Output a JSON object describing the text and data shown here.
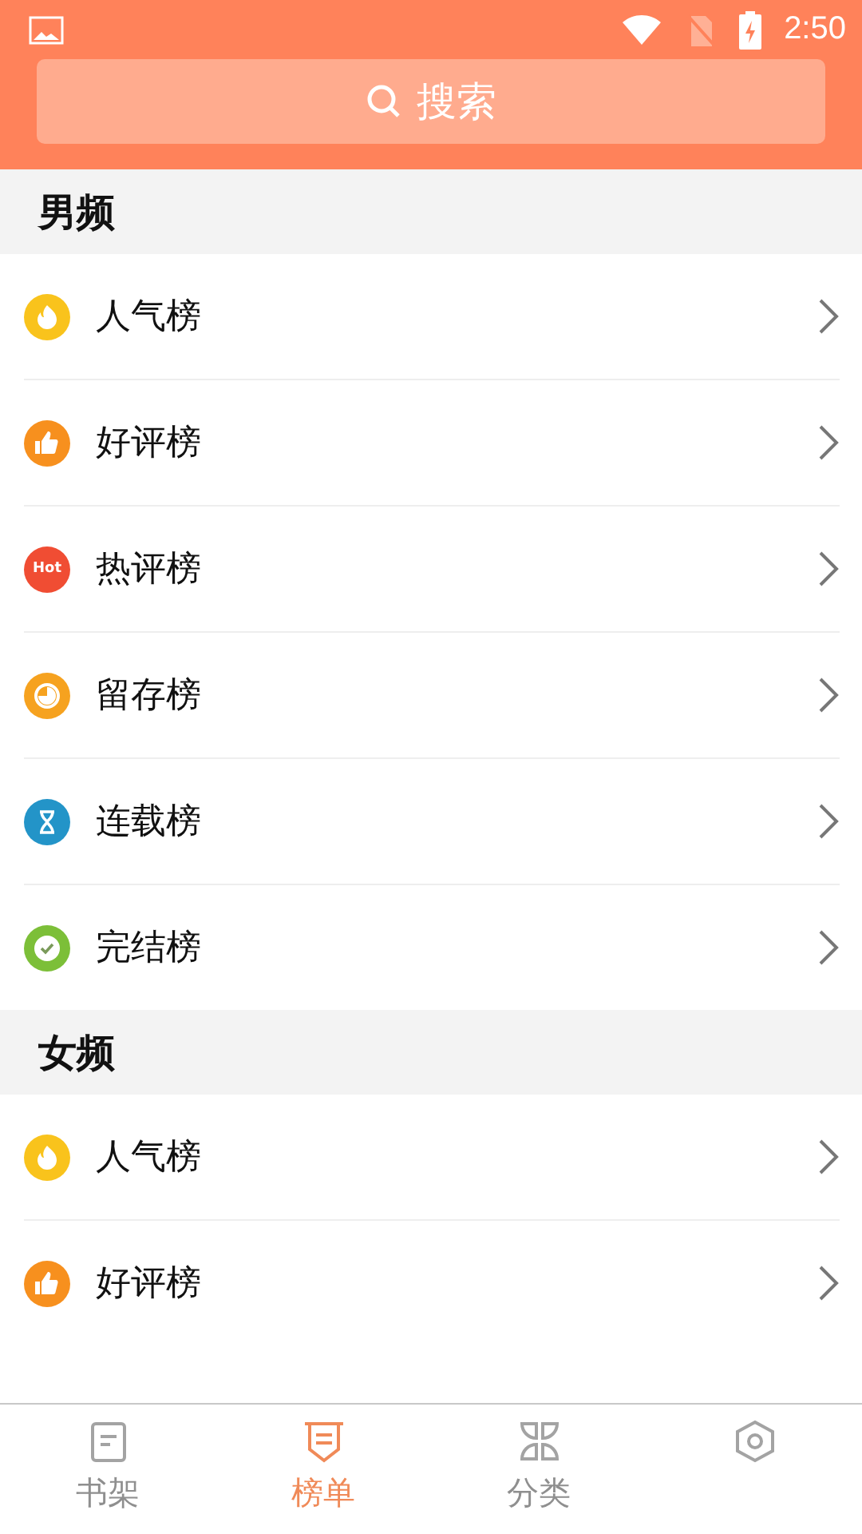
{
  "status_bar": {
    "time": "2:50"
  },
  "search": {
    "placeholder": "搜索"
  },
  "sections": [
    {
      "title": "男频",
      "items": [
        {
          "label": "人气榜",
          "kind": "flame",
          "color": "#f9c31c"
        },
        {
          "label": "好评榜",
          "kind": "thumb",
          "color": "#f7901e"
        },
        {
          "label": "热评榜",
          "kind": "hot",
          "color": "#f04d33",
          "badge": "Hot"
        },
        {
          "label": "留存榜",
          "kind": "clock",
          "color": "#f6a21f"
        },
        {
          "label": "连载榜",
          "kind": "hourglass",
          "color": "#2394c8"
        },
        {
          "label": "完结榜",
          "kind": "check",
          "color": "#7cbf38"
        }
      ]
    },
    {
      "title": "女频",
      "items": [
        {
          "label": "人气榜",
          "kind": "flame",
          "color": "#f9c31c"
        },
        {
          "label": "好评榜",
          "kind": "thumb",
          "color": "#f7901e"
        }
      ]
    }
  ],
  "tabs": [
    {
      "label": "书架",
      "kind": "shelf",
      "selected": false
    },
    {
      "label": "榜单",
      "kind": "rank",
      "selected": true
    },
    {
      "label": "分类",
      "kind": "grid",
      "selected": false
    },
    {
      "kind": "profile",
      "selected": false
    }
  ]
}
